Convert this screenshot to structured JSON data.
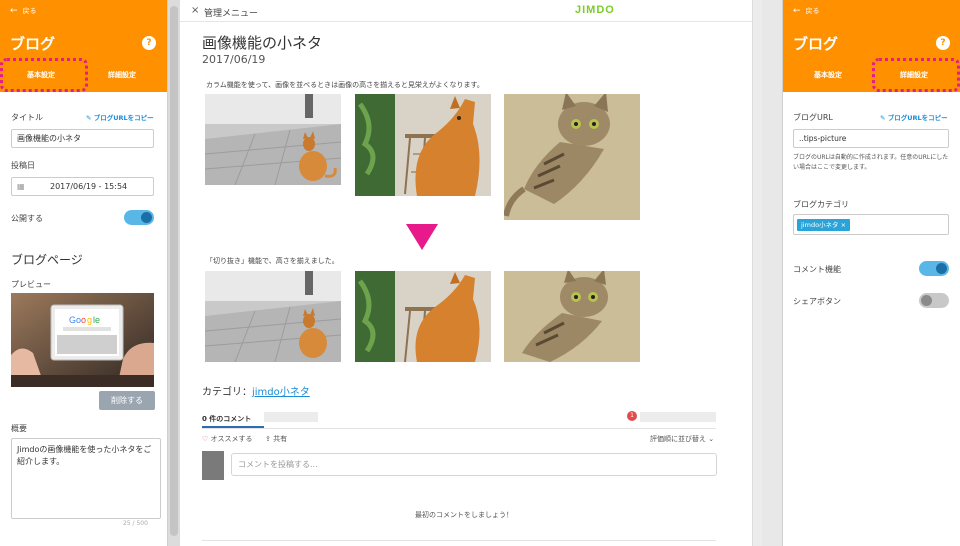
{
  "left_panel": {
    "back_label": "戻る",
    "title": "ブログ",
    "help": "?",
    "tabs": [
      "基本設定",
      "詳細設定"
    ],
    "title_field": {
      "label": "タイトル",
      "copy_link": "ブログURLをコピー",
      "value": "画像機能の小ネタ"
    },
    "date_field": {
      "label": "投稿日",
      "value": "2017/06/19 - 15:54"
    },
    "publish_toggle": {
      "label": "公開する",
      "on": true
    },
    "blog_page_heading": "ブログページ",
    "preview_label": "プレビュー",
    "delete_button": "削除する",
    "summary_label": "概要",
    "summary_text": "Jimdoの画像機能を使った小ネタをご紹介します。",
    "char_count": "25 / 500"
  },
  "middle_panel": {
    "close_icon": "×",
    "menu_label": "管理メニュー",
    "logo_text": "JIMDO",
    "post_title": "画像機能の小ネタ",
    "post_date": "2017/06/19",
    "intro_text": "カラム機能を使って、画像を並べるときは画像の高さを揃えると見栄えがよくなります。",
    "cropped_text": "「切り抜き」機能で、高さを揃えました。",
    "category_label": "カテゴリ：",
    "category_link": "jimdo小ネタ",
    "comments_tab": "0 件のコメント",
    "notif_count": "1",
    "recommend_label": "オススメする",
    "share_label": "共有",
    "sort_label": "評価順に並び替え",
    "comment_placeholder": "コメントを投稿する...",
    "first_comment": "最初のコメントをしましょう！"
  },
  "right_panel": {
    "back_label": "戻る",
    "title": "ブログ",
    "help": "?",
    "tabs": [
      "基本設定",
      "詳細設定"
    ],
    "url_field": {
      "label": "ブログURL",
      "copy_link": "ブログURLをコピー",
      "value": "..tips-picture"
    },
    "url_note": "ブログのURLは自動的に作成されます。任意のURLにしたい場合はここで変更します。",
    "category_field": {
      "label": "ブログカテゴリ",
      "tag": "jimdo小ネタ",
      "tag_remove": "×"
    },
    "comment_toggle": {
      "label": "コメント機能",
      "on": true
    },
    "share_toggle": {
      "label": "シェアボタン",
      "on": false
    }
  },
  "colors": {
    "brand_orange": "#ff9100",
    "highlight_pink": "#e8198b",
    "toggle_blue": "#59b7e8",
    "link_blue": "#1a8cd8"
  }
}
